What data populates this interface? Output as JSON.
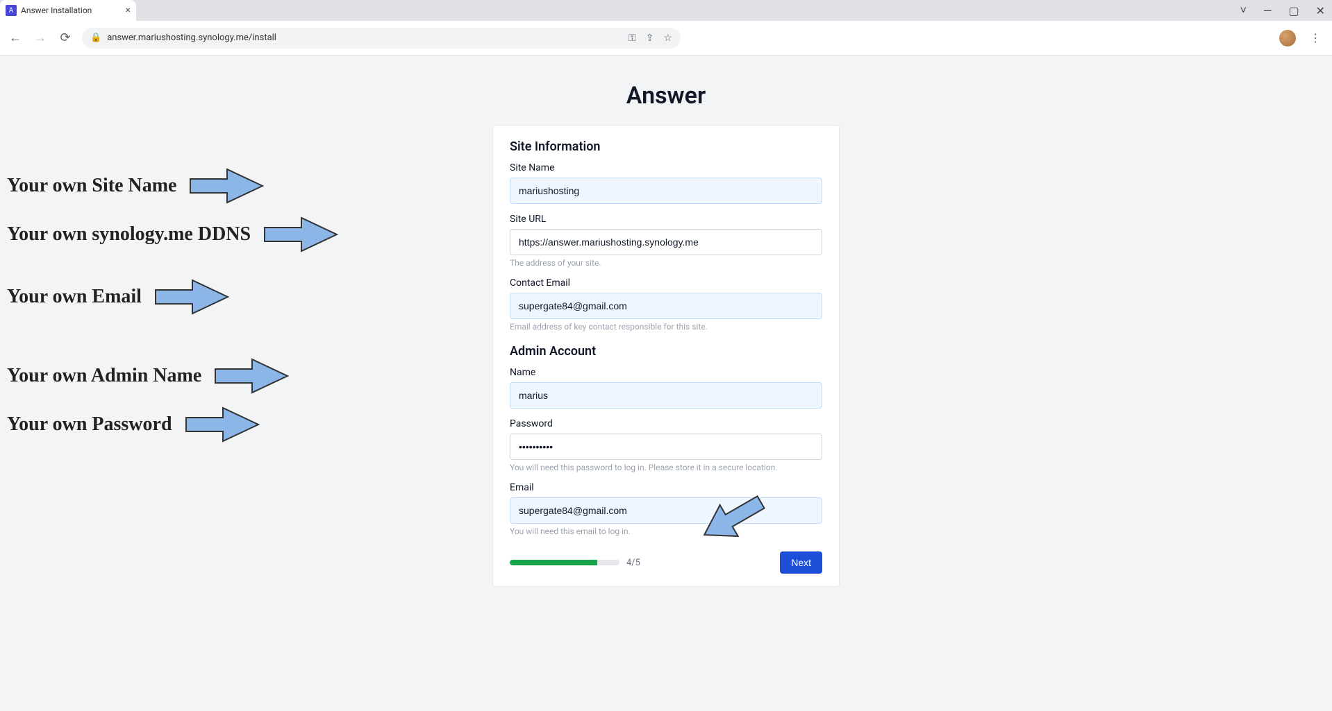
{
  "browser": {
    "tab_title": "Answer Installation",
    "url": "answer.mariushosting.synology.me/install"
  },
  "page": {
    "title": "Answer",
    "section1": "Site Information",
    "section2": "Admin Account",
    "site_name_label": "Site Name",
    "site_name_value": "mariushosting",
    "site_url_label": "Site URL",
    "site_url_value": "https://answer.mariushosting.synology.me",
    "site_url_hint": "The address of your site.",
    "contact_email_label": "Contact Email",
    "contact_email_value": "supergate84@gmail.com",
    "contact_email_hint": "Email address of key contact responsible for this site.",
    "admin_name_label": "Name",
    "admin_name_value": "marius",
    "password_label": "Password",
    "password_value": "••••••••••",
    "password_hint": "You will need this password to log in. Please store it in a secure location.",
    "admin_email_label": "Email",
    "admin_email_value": "supergate84@gmail.com",
    "admin_email_hint": "You will need this email to log in.",
    "progress_label": "4/5",
    "next_label": "Next"
  },
  "annotations": {
    "site_name": "Your own Site Name",
    "ddns": "Your own synology.me DDNS",
    "email": "Your own Email",
    "admin_name": "Your own Admin Name",
    "password": "Your own Password"
  }
}
